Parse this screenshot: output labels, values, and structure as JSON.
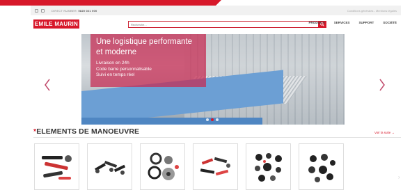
{
  "topbar": {
    "phone_label": "DIRECT NUMBER:",
    "phone_number": "0820 021 000",
    "right_text": "Conditions générales - Mentions légales"
  },
  "header": {
    "logo_text": "EMILE MAURIN",
    "search_placeholder": "Recherche...",
    "nav": [
      "PRODUITS",
      "SERVICES",
      "SUPPORT",
      "SOCIÉTÉ"
    ]
  },
  "hero": {
    "title_line1": "Une logistique performante",
    "title_line2": "et moderne",
    "bullets": [
      "Livraison en 24h",
      "Code barre personnalisable",
      "Suivi en temps réel"
    ],
    "dot_count": 3,
    "active_dot": 1
  },
  "section": {
    "star": "*",
    "title": "ELEMENTS DE MANOEUVRE",
    "see_all": "Voir la suite →"
  },
  "colors": {
    "brand": "#d7182a",
    "caption": "#c82850"
  },
  "icons": {
    "prev": "chevron-left-icon",
    "next": "chevron-right-icon",
    "search": "search-icon"
  }
}
